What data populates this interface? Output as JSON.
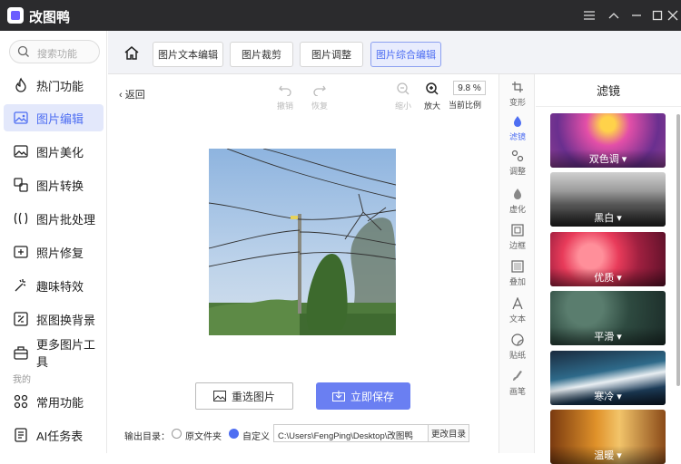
{
  "app": {
    "title": "改图鸭"
  },
  "search": {
    "placeholder": "搜索功能"
  },
  "sidebar": {
    "items": [
      {
        "label": "热门功能",
        "icon": "fire-icon"
      },
      {
        "label": "图片编辑",
        "icon": "image-edit-icon",
        "active": true
      },
      {
        "label": "图片美化",
        "icon": "image-beauty-icon"
      },
      {
        "label": "图片转换",
        "icon": "convert-icon"
      },
      {
        "label": "图片批处理",
        "icon": "batch-icon"
      },
      {
        "label": "照片修复",
        "icon": "repair-icon"
      },
      {
        "label": "趣味特效",
        "icon": "effects-icon"
      },
      {
        "label": "抠图换背景",
        "icon": "cutout-icon"
      },
      {
        "label": "更多图片工具",
        "icon": "toolbox-icon"
      }
    ],
    "section_mine": "我的",
    "mine_items": [
      {
        "label": "常用功能",
        "icon": "grid-icon"
      },
      {
        "label": "AI任务表",
        "icon": "ai-icon"
      }
    ]
  },
  "tabs": [
    {
      "label": "图片文本编辑"
    },
    {
      "label": "图片裁剪"
    },
    {
      "label": "图片调整"
    },
    {
      "label": "图片综合编辑",
      "active": true
    }
  ],
  "toolbar": {
    "back": "返回",
    "undo": "撤销",
    "redo": "恢复",
    "zoom_out": "缩小",
    "zoom_in": "放大",
    "zoom_value": "9.8 %",
    "zoom_label": "当前比例"
  },
  "actions": {
    "reselect": "重选图片",
    "save": "立即保存"
  },
  "output": {
    "label": "输出目录：",
    "opt_original": "原文件夹",
    "opt_custom": "自定义",
    "path": "C:\\Users\\FengPing\\Desktop\\改图鸭",
    "change": "更改目录"
  },
  "right_tools": [
    {
      "label": "变形",
      "icon": "transform-icon"
    },
    {
      "label": "滤镜",
      "icon": "filter-icon",
      "active": true
    },
    {
      "label": "调整",
      "icon": "adjust-icon"
    },
    {
      "label": "虚化",
      "icon": "blur-icon"
    },
    {
      "label": "边框",
      "icon": "border-icon"
    },
    {
      "label": "叠加",
      "icon": "overlay-icon"
    },
    {
      "label": "文本",
      "icon": "text-icon"
    },
    {
      "label": "贴纸",
      "icon": "sticker-icon"
    },
    {
      "label": "画笔",
      "icon": "brush-icon"
    }
  ],
  "filters": {
    "title": "滤镜",
    "items": [
      {
        "label": "双色调"
      },
      {
        "label": "黑白"
      },
      {
        "label": "优质"
      },
      {
        "label": "平滑"
      },
      {
        "label": "寒冷"
      },
      {
        "label": "温暖"
      }
    ]
  },
  "colors": {
    "accent": "#4e6ef2",
    "titlebar": "#2b2b2d",
    "save_button": "#6a7ff2"
  }
}
